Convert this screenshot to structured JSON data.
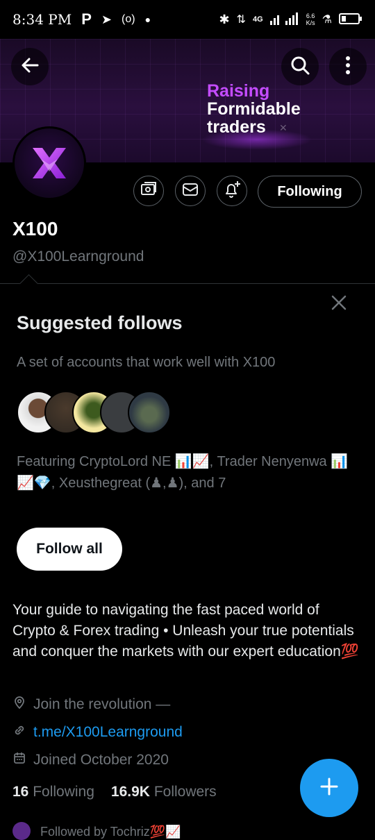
{
  "status_bar": {
    "time": "8:34 PM",
    "network": "4G",
    "speed_value": "6.6",
    "speed_unit": "K/s"
  },
  "banner": {
    "line1": "Raising",
    "line2": "Formidable",
    "line3": "traders"
  },
  "profile": {
    "name": "X100",
    "handle": "@X100Learnground",
    "following_button": "Following"
  },
  "suggested": {
    "title": "Suggested follows",
    "subtitle": "A set of accounts that work well with X100",
    "featuring": "Featuring CryptoLord NE 📊📈, Trader Nenyenwa 📊📈💎, Xeusthegreat (♟,♟), and 7",
    "follow_all": "Follow all"
  },
  "bio": "Your guide to navigating the fast paced world of Crypto & Forex trading • Unleash your true potentials and conquer the markets with our expert education💯",
  "meta": {
    "location": "Join the revolution —",
    "link": "t.me/X100Learnground",
    "joined": "Joined October 2020"
  },
  "counts": {
    "following_num": "16",
    "following_label": "Following",
    "followers_num": "16.9K",
    "followers_label": "Followers"
  },
  "followed_by": "Followed by Tochriz💯📈",
  "colors": {
    "accent": "#1d9bf0",
    "banner_purple": "#c44cff",
    "muted": "#71767b"
  },
  "icons": [
    "back-arrow-icon",
    "search-icon",
    "more-vertical-icon",
    "x100-logo-icon",
    "subscribe-icon",
    "message-icon",
    "notification-add-icon",
    "close-icon",
    "location-icon",
    "link-icon",
    "calendar-icon",
    "compose-plus-icon"
  ]
}
